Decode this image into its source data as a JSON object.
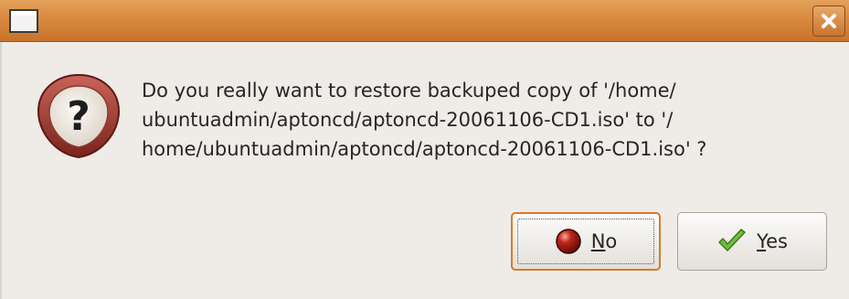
{
  "dialog": {
    "title": "",
    "message_lines": [
      "Do you really want to restore backuped copy of '/home/",
      "ubuntuadmin/aptoncd/aptoncd-20061106-CD1.iso' to '/",
      "home/ubuntuadmin/aptoncd/aptoncd-20061106-CD1.iso' ?"
    ],
    "icon": "question-warning-icon"
  },
  "buttons": {
    "no": {
      "mnemonic": "N",
      "rest": "o",
      "icon": "stop-icon",
      "focused": true
    },
    "yes": {
      "mnemonic": "Y",
      "rest": "es",
      "icon": "check-icon"
    }
  },
  "colors": {
    "titlebar": "#d98a3e",
    "background": "#efebe7",
    "focus_border": "#d97b27"
  }
}
